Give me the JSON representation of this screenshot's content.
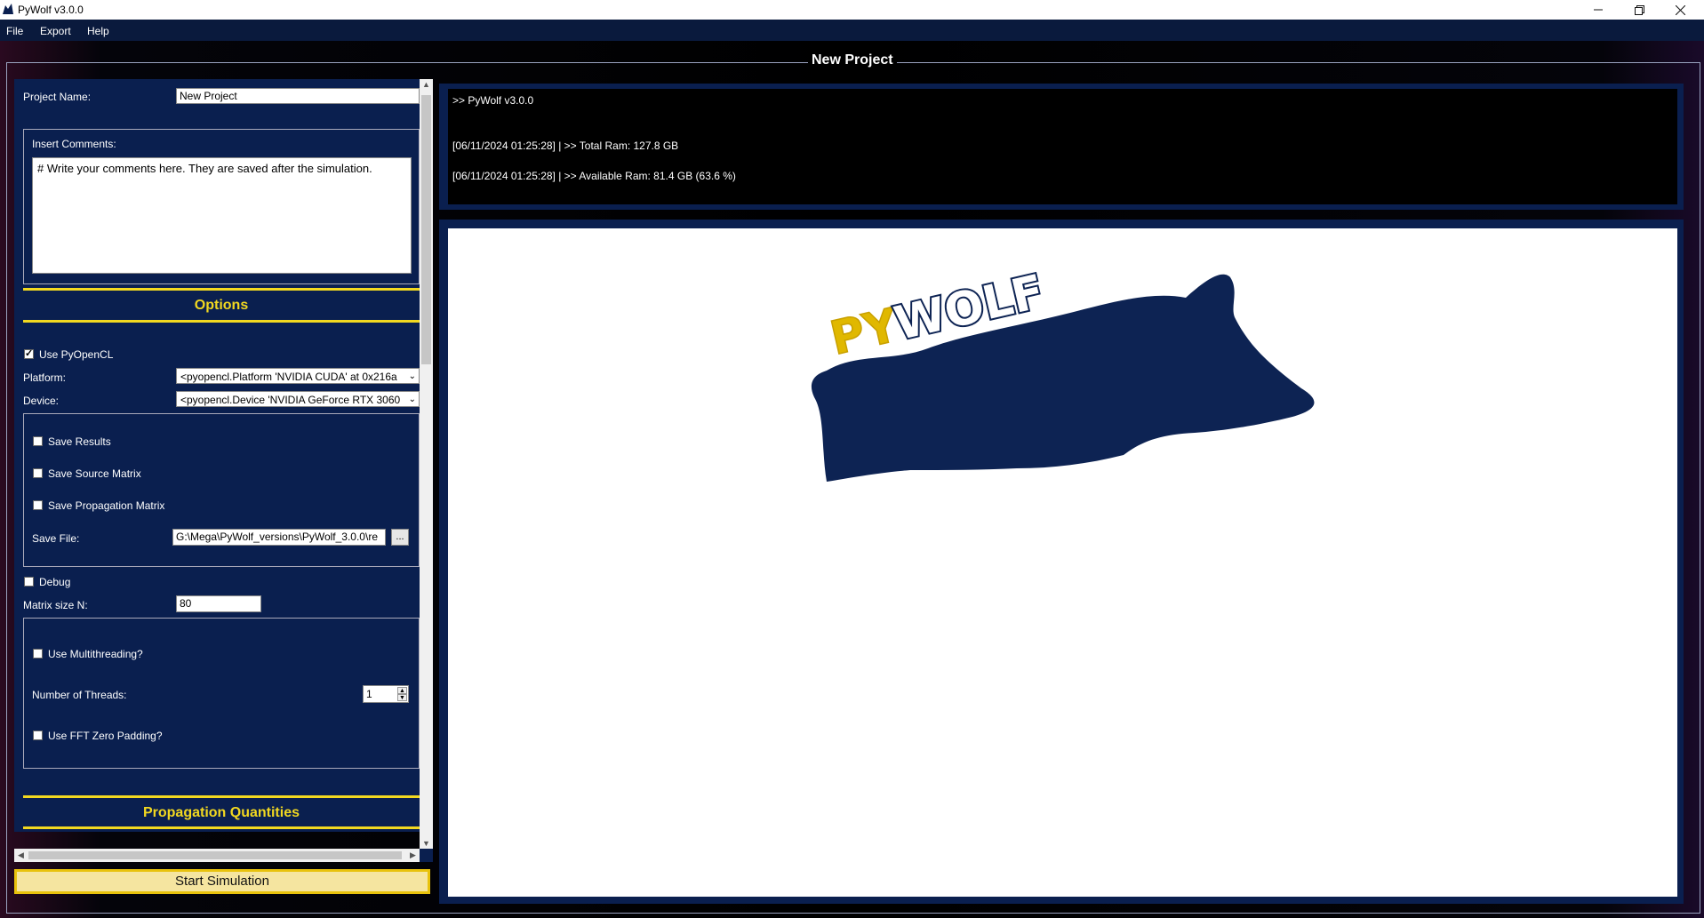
{
  "window": {
    "title": "PyWolf v3.0.0"
  },
  "menu": {
    "items": [
      "File",
      "Export",
      "Help"
    ]
  },
  "group": {
    "title": "New Project"
  },
  "project": {
    "name_label": "Project Name:",
    "name_value": "New Project",
    "comments_label": "Insert Comments:",
    "comments_value": "# Write your comments here. They are saved after the simulation."
  },
  "options": {
    "heading": "Options",
    "use_pyopencl_label": "Use PyOpenCL",
    "platform_label": "Platform:",
    "platform_value": "<pyopencl.Platform 'NVIDIA CUDA' at 0x216a",
    "device_label": "Device:",
    "device_value": "<pyopencl.Device 'NVIDIA GeForce RTX 3060",
    "save_results_label": "Save Results",
    "save_source_matrix_label": "Save Source Matrix",
    "save_propagation_matrix_label": "Save Propagation Matrix",
    "save_file_label": "Save File:",
    "save_file_value": "G:\\Mega\\PyWolf_versions\\PyWolf_3.0.0\\re",
    "browse_label": "...",
    "debug_label": "Debug",
    "matrix_size_label": "Matrix size N:",
    "matrix_size_value": "80",
    "multithreading_label": "Use Multithreading?",
    "threads_label": "Number of Threads:",
    "threads_value": "1",
    "fft_padding_label": "Use FFT Zero Padding?"
  },
  "propagation": {
    "heading": "Propagation Quantities"
  },
  "start_button": "Start Simulation",
  "console": {
    "lines": [
      ">> PyWolf v3.0.0",
      "[06/11/2024 01:25:28]  | >> Total Ram: 127.8 GB",
      "[06/11/2024 01:25:28]  | >> Available Ram: 81.4 GB (63.6 %)"
    ]
  },
  "logo": {
    "text_py": "PY",
    "text_wolf": "WOLF"
  }
}
